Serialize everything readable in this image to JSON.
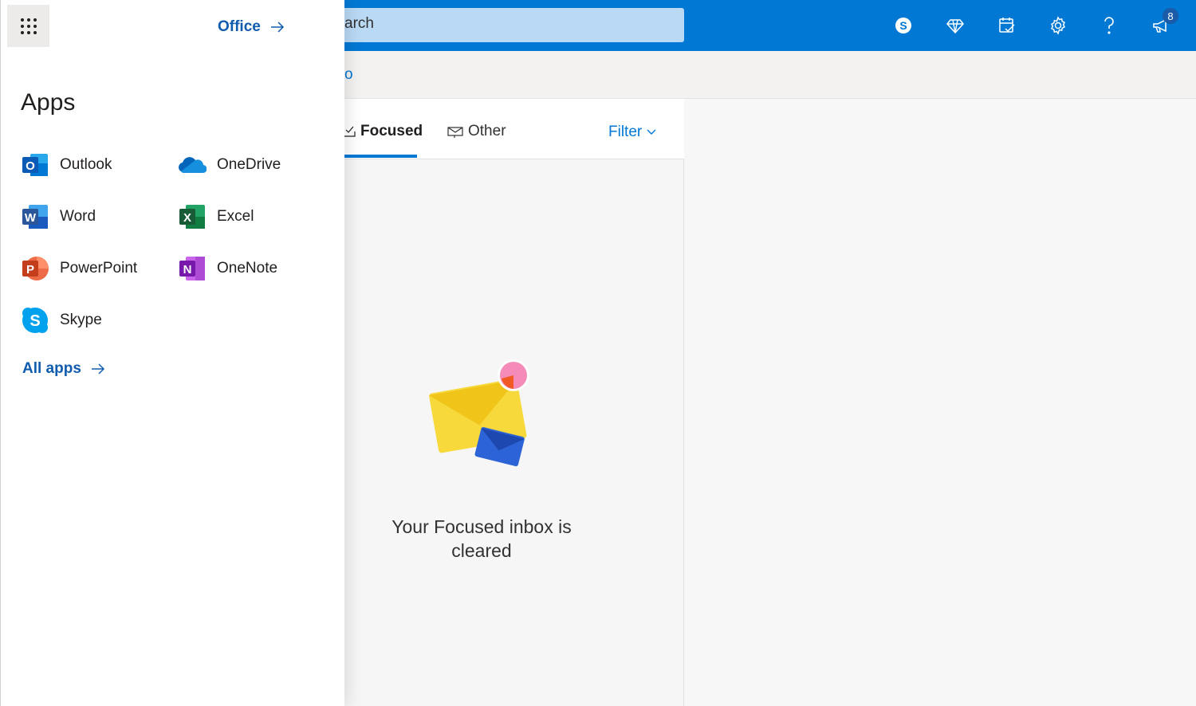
{
  "search": {
    "visible_text": "arch"
  },
  "commandbar": {
    "visible_text": "o"
  },
  "topbar": {
    "icons": [
      "skype-icon",
      "diamond-icon",
      "calendar-check-icon",
      "gear-icon",
      "help-icon",
      "megaphone-icon"
    ],
    "notification_count": "8"
  },
  "launcher": {
    "office_label": "Office",
    "heading": "Apps",
    "apps": [
      {
        "label": "Outlook"
      },
      {
        "label": "OneDrive"
      },
      {
        "label": "Word"
      },
      {
        "label": "Excel"
      },
      {
        "label": "PowerPoint"
      },
      {
        "label": "OneNote"
      },
      {
        "label": "Skype"
      }
    ],
    "all_apps_label": "All apps"
  },
  "mail": {
    "tabs": [
      {
        "label": "Focused"
      },
      {
        "label": "Other"
      }
    ],
    "filter_label": "Filter",
    "empty_message": "Your Focused inbox is cleared"
  },
  "colors": {
    "accent": "#0078d4",
    "link": "#0f5cae"
  }
}
